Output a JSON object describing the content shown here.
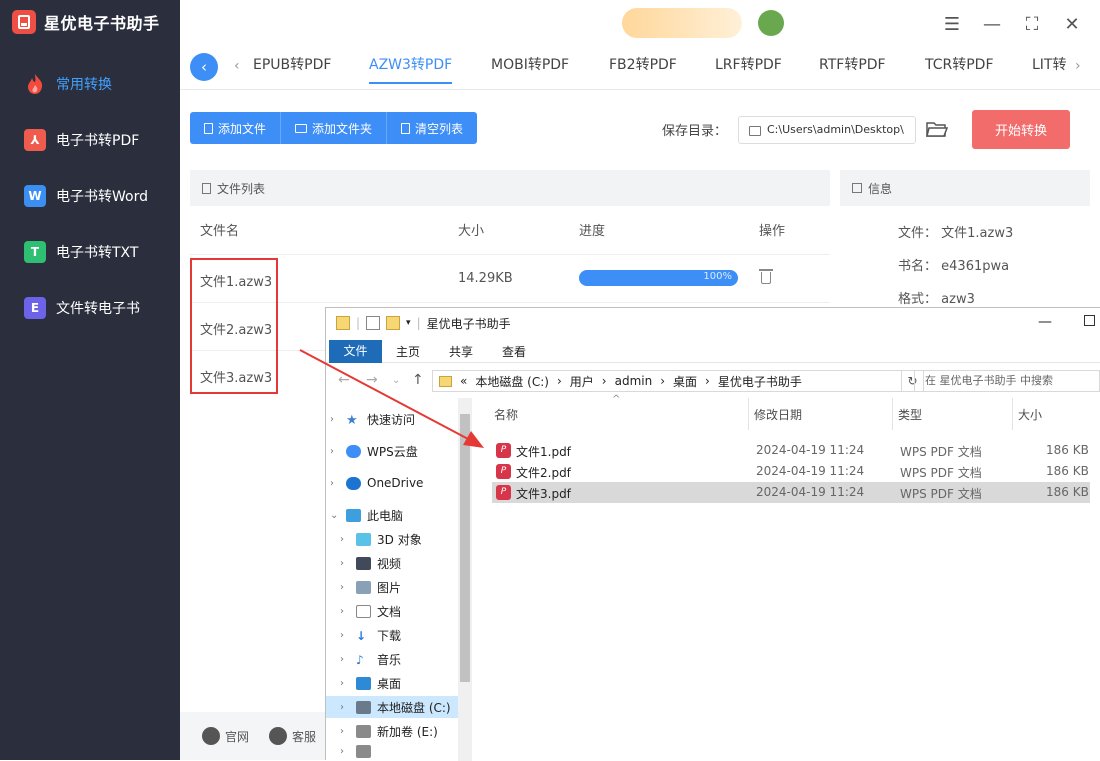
{
  "app": {
    "title": "星优电子书助手"
  },
  "sidebar": {
    "items": [
      {
        "label": "常用转换",
        "icon": "flame-icon"
      },
      {
        "label": "电子书转PDF",
        "icon": "pdf-icon",
        "badge": "PDF"
      },
      {
        "label": "电子书转Word",
        "icon": "word-icon",
        "badge": "W"
      },
      {
        "label": "电子书转TXT",
        "icon": "txt-icon",
        "badge": "T"
      },
      {
        "label": "文件转电子书",
        "icon": "ebook-icon",
        "badge": "E"
      }
    ],
    "footer": {
      "website": "官网",
      "service": "客服"
    }
  },
  "tabs": [
    "EPUB转PDF",
    "AZW3转PDF",
    "MOBI转PDF",
    "FB2转PDF",
    "LRF转PDF",
    "RTF转PDF",
    "TCR转PDF",
    "LIT转"
  ],
  "toolbar": {
    "add_file": "添加文件",
    "add_folder": "添加文件夹",
    "clear": "清空列表"
  },
  "save": {
    "label": "保存目录：",
    "path": "C:\\Users\\admin\\Desktop\\"
  },
  "start_button": "开始转换",
  "file_list": {
    "title": "文件列表",
    "columns": {
      "name": "文件名",
      "size": "大小",
      "progress": "进度",
      "action": "操作"
    },
    "rows": [
      {
        "name": "文件1.azw3",
        "size": "14.29KB",
        "progress": 100,
        "progress_text": "100%"
      },
      {
        "name": "文件2.azw3",
        "size": "",
        "progress": null,
        "progress_text": ""
      },
      {
        "name": "文件3.azw3",
        "size": "",
        "progress": null,
        "progress_text": ""
      }
    ]
  },
  "info": {
    "title": "信息",
    "file_label": "文件：",
    "file_value": "文件1.azw3",
    "book_label": "书名：",
    "book_value": "e4361pwa",
    "format_label": "格式：",
    "format_value": "azw3"
  },
  "explorer": {
    "title": "星优电子书助手",
    "ribbon": {
      "file": "文件",
      "home": "主页",
      "share": "共享",
      "view": "查看"
    },
    "address": [
      "«",
      "本地磁盘 (C:)",
      "›",
      "用户",
      "›",
      "admin",
      "›",
      "桌面",
      "›",
      "星优电子书助手"
    ],
    "search_placeholder": "在 星优电子书助手 中搜索",
    "tree": [
      {
        "label": "快速访问",
        "icon": "star-icon"
      },
      {
        "label": "WPS云盘",
        "icon": "cloud-icon"
      },
      {
        "label": "OneDrive",
        "icon": "onedrive-icon"
      },
      {
        "label": "此电脑",
        "icon": "computer-icon"
      },
      {
        "label": "3D 对象",
        "icon": "cube-icon"
      },
      {
        "label": "视频",
        "icon": "video-icon"
      },
      {
        "label": "图片",
        "icon": "picture-icon"
      },
      {
        "label": "文档",
        "icon": "document-icon"
      },
      {
        "label": "下载",
        "icon": "download-icon"
      },
      {
        "label": "音乐",
        "icon": "music-icon"
      },
      {
        "label": "桌面",
        "icon": "desktop-icon"
      },
      {
        "label": "本地磁盘 (C:)",
        "icon": "drive-icon"
      },
      {
        "label": "新加卷 (E:)",
        "icon": "drive-icon"
      }
    ],
    "columns": {
      "name": "名称",
      "date": "修改日期",
      "type": "类型",
      "size": "大小"
    },
    "files": [
      {
        "name": "文件1.pdf",
        "date": "2024-04-19 11:24",
        "type": "WPS PDF 文档",
        "size": "186 KB"
      },
      {
        "name": "文件2.pdf",
        "date": "2024-04-19 11:24",
        "type": "WPS PDF 文档",
        "size": "186 KB"
      },
      {
        "name": "文件3.pdf",
        "date": "2024-04-19 11:24",
        "type": "WPS PDF 文档",
        "size": "186 KB"
      }
    ]
  },
  "colors": {
    "sidebar_bg": "#2b2f3d",
    "accent": "#3d8ef6",
    "start": "#f16c6a",
    "highlight": "#e53935"
  }
}
